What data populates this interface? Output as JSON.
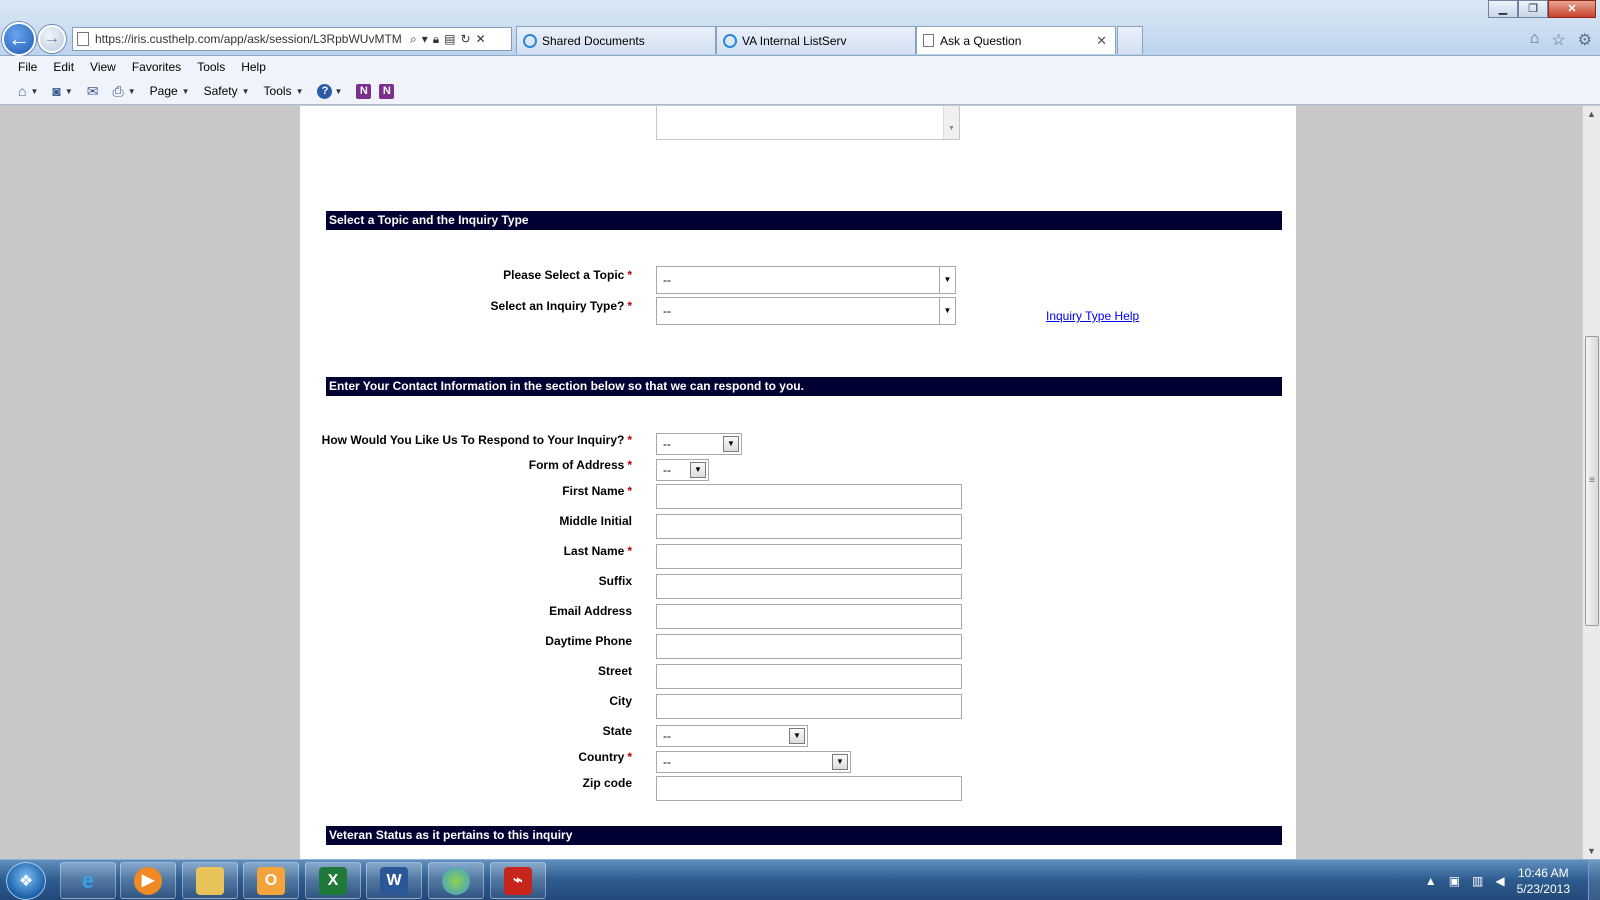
{
  "browser": {
    "window_controls": {
      "minimize": "▁",
      "restore": "❐",
      "close": "✕"
    },
    "address_url": "https://iris.custhelp.com/app/ask/session/L3RpbWUvMTM",
    "tabs": [
      {
        "label": "Shared Documents",
        "icon": "ie-icon"
      },
      {
        "label": "VA Internal ListServ",
        "icon": "ie-icon"
      },
      {
        "label": "Ask a Question",
        "icon": "page-icon",
        "active": true
      }
    ],
    "menu": [
      "File",
      "Edit",
      "View",
      "Favorites",
      "Tools",
      "Help"
    ],
    "commands": {
      "page": "Page",
      "safety": "Safety",
      "tools": "Tools",
      "help_glyph": "?",
      "onenote_glyph": "N"
    }
  },
  "form": {
    "section_topic": "Select a Topic and the Inquiry Type",
    "topic_label": "Please Select a Topic",
    "topic_value": "--",
    "inquiry_type_label": "Select an Inquiry Type?",
    "inquiry_type_value": "--",
    "inquiry_help_link": "Inquiry Type Help",
    "section_contact": "Enter Your Contact Information in the section below so that we can respond to you.",
    "respond_label": "How Would You Like Us To Respond to Your Inquiry?",
    "respond_value": "--",
    "form_of_address_label": "Form of Address",
    "form_of_address_value": "--",
    "first_name_label": "First Name",
    "middle_initial_label": "Middle Initial",
    "last_name_label": "Last Name",
    "suffix_label": "Suffix",
    "email_label": "Email Address",
    "phone_label": "Daytime Phone",
    "street_label": "Street",
    "city_label": "City",
    "state_label": "State",
    "state_value": "--",
    "country_label": "Country",
    "country_value": "--",
    "zip_label": "Zip code",
    "required_mark": "*",
    "section_veteran": "Veteran Status as it pertains to this inquiry"
  },
  "taskbar": {
    "apps": [
      "internet-explorer",
      "media-player",
      "windows-explorer",
      "outlook",
      "excel",
      "word",
      "lync",
      "adobe-reader"
    ],
    "clock_time": "10:46 AM",
    "clock_date": "5/23/2013"
  }
}
